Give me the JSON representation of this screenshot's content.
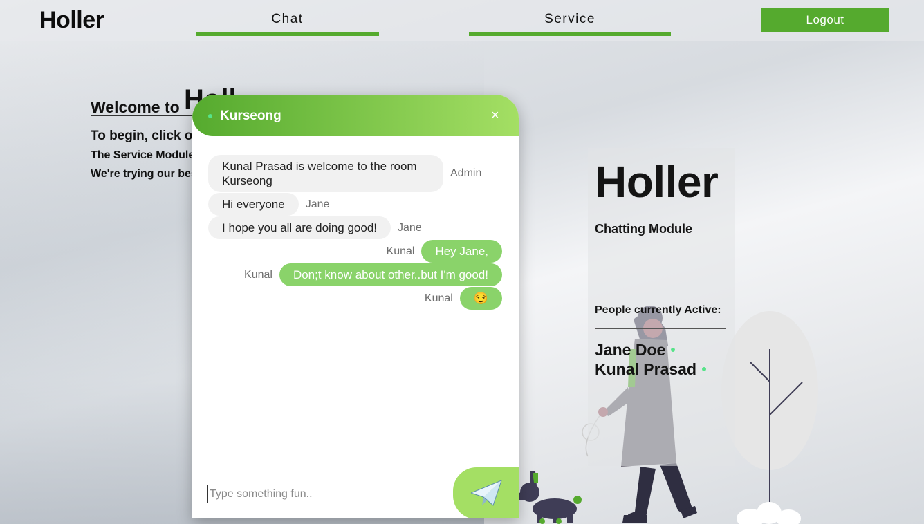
{
  "header": {
    "brand": "Holler",
    "nav": [
      {
        "label": "Chat"
      },
      {
        "label": "Service"
      }
    ],
    "logout_label": "Logout"
  },
  "welcome": {
    "title_prefix": "Welcome to",
    "title_big": "Holl",
    "line1": "To begin, click on",
    "line2": "The Service Module",
    "line3": "We're trying our best"
  },
  "side_panel": {
    "title": "Holler",
    "subtitle": "Chatting Module",
    "active_label": "People currently Active:",
    "users": [
      {
        "name": "Jane Doe"
      },
      {
        "name": "Kunal Prasad"
      }
    ],
    "status_color": "#57e389"
  },
  "chat": {
    "room_name": "Kurseong",
    "close_icon": "×",
    "messages": [
      {
        "sender": "Admin",
        "text": "Kunal Prasad is welcome to the room Kurseong",
        "mine": false
      },
      {
        "sender": "Jane",
        "text": "Hi everyone",
        "mine": false
      },
      {
        "sender": "Jane",
        "text": "I hope you all are doing good!",
        "mine": false
      },
      {
        "sender": "Kunal",
        "text": "Hey Jane,",
        "mine": true
      },
      {
        "sender": "Kunal",
        "text": "Don;t know about other..but I'm good!",
        "mine": true
      },
      {
        "sender": "Kunal",
        "text": "😏",
        "mine": true
      }
    ],
    "input_placeholder": "Type something fun..",
    "input_value": "",
    "send_icon": "paper-plane-icon"
  },
  "colors": {
    "accent": "#55aa2e",
    "accent_light": "#a4df64",
    "my_bubble": "#8ad36a",
    "other_bubble": "#f1f1f1"
  }
}
